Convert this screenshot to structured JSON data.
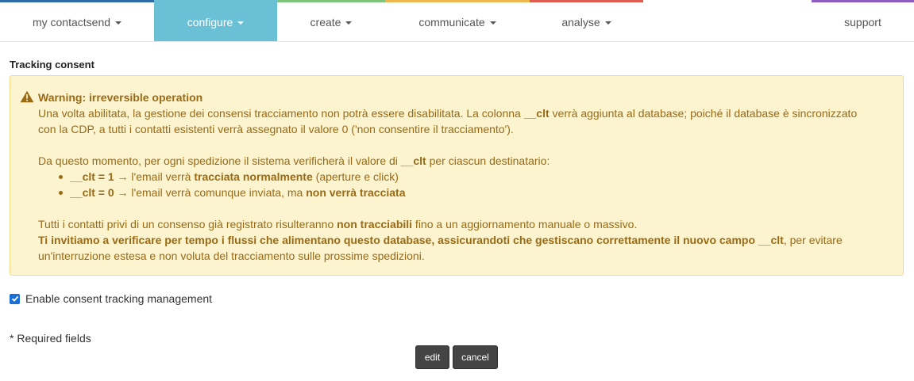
{
  "nav": {
    "items": [
      {
        "label": "my contactsend",
        "caret": true
      },
      {
        "label": "configure",
        "caret": true,
        "active": true
      },
      {
        "label": "create",
        "caret": true
      },
      {
        "label": "communicate",
        "caret": true
      },
      {
        "label": "analyse",
        "caret": true
      },
      {
        "label": "support",
        "caret": false
      }
    ],
    "colors": [
      "#2c6ca7",
      "#6ac1d6",
      "#80c47d",
      "#efb74f",
      "#e05a52",
      "#8e5cc2"
    ]
  },
  "page": {
    "section_title": "Tracking consent"
  },
  "warning": {
    "icon": "warning-triangle-icon",
    "title": "Warning: irreversible operation",
    "p1_a": "Una volta abilitata, la gestione dei consensi tracciamento non potrà essere disabilitata. La colonna ",
    "p1_b": "__clt",
    "p1_c": " verrà aggiunta al database; poiché il database è sincronizzato",
    "p1_d": "con la CDP, a tutti i contatti esistenti verrà assegnato il valore 0 ('non consentire il tracciamento').",
    "p2_a": "Da questo momento, per ogni spedizione il sistema verificherà il valore di ",
    "p2_b": "__clt",
    "p2_c": " per ciascun destinatario:",
    "li1_a": "__clt = 1",
    "li1_b": " → l'email verrà ",
    "li1_c": "tracciata normalmente",
    "li1_d": " (aperture e click)",
    "li2_a": "__clt = 0",
    "li2_b": " → l'email verrà comunque inviata, ma ",
    "li2_c": "non verrà tracciata",
    "p3_a": "Tutti i contatti privi di un consenso già registrato risulteranno ",
    "p3_b": "non tracciabili",
    "p3_c": " fino a un aggiornamento manuale o massivo.",
    "p4_a": "Ti invitiamo a verificare per tempo i flussi che alimentano questo database, assicurandoti che gestiscano correttamente il nuovo campo __clt",
    "p4_b": ", per evitare",
    "p4_c": "un'interruzione estesa e non voluta del tracciamento sulle prossime spedizioni."
  },
  "form": {
    "consent_label": "Enable consent tracking management",
    "consent_checked": true,
    "required_note": "* Required fields",
    "edit_label": "edit",
    "cancel_label": "cancel"
  }
}
